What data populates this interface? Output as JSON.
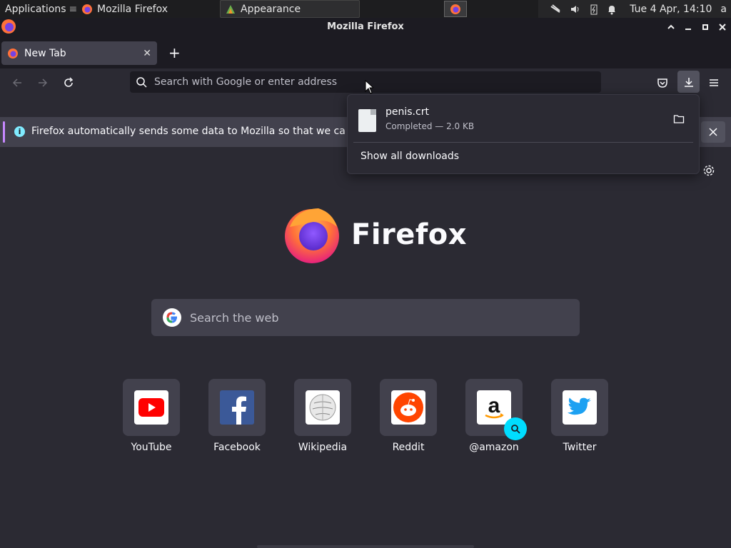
{
  "taskbar": {
    "applications_label": "Applications",
    "window_firefox": "Mozilla Firefox",
    "window_appearance": "Appearance",
    "clock": "Tue  4 Apr, 14:10",
    "user": "a"
  },
  "titlebar": {
    "title": "Mozilla Firefox"
  },
  "tab": {
    "label": "New Tab"
  },
  "urlbar": {
    "placeholder": "Search with Google or enter address"
  },
  "notice": {
    "message": "Firefox automatically sends some data to Mozilla so that we can improve your experience."
  },
  "downloads": {
    "file_name": "penis.crt",
    "status": "Completed — 2.0 KB",
    "show_all": "Show all downloads"
  },
  "newtab": {
    "logo_text": "Firefox",
    "search_placeholder": "Search the web",
    "top_sites": [
      {
        "label": "YouTube"
      },
      {
        "label": "Facebook"
      },
      {
        "label": "Wikipedia"
      },
      {
        "label": "Reddit"
      },
      {
        "label": "@amazon"
      },
      {
        "label": "Twitter"
      }
    ]
  },
  "colors": {
    "accent": "#00ddff",
    "notice_accent": "#c688ff",
    "background": "#2b2a33"
  }
}
